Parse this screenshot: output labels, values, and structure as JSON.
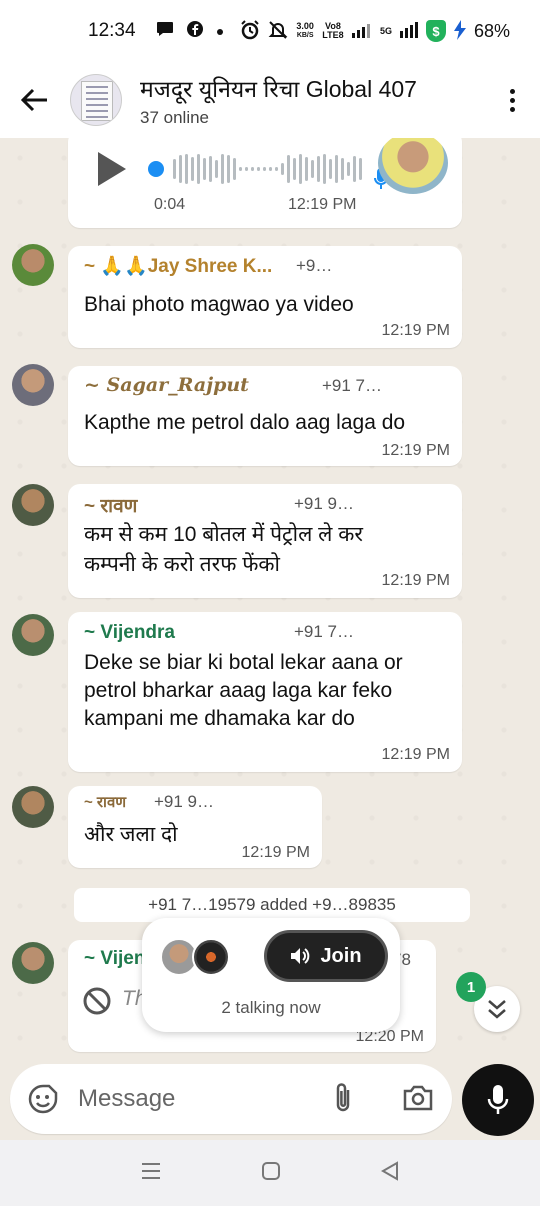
{
  "status_bar": {
    "time": "12:34",
    "net_speed_value": "3.00",
    "net_speed_unit": "KB/S",
    "volte": "Vo8 LTE8",
    "network": "5G",
    "battery": "68%",
    "icons": [
      "chat-bubble-icon",
      "facebook-icon",
      "dot-icon",
      "alarm-icon",
      "mute-icon",
      "signal-icon",
      "shield-icon",
      "charging-icon"
    ]
  },
  "header": {
    "title": "मजदूर यूनियन रिचा Global 407",
    "subtitle": "37 online"
  },
  "voice_note": {
    "duration": "0:04",
    "time": "12:19 PM"
  },
  "messages": [
    {
      "sender": "~ 🙏🙏Jay Shree K...",
      "phone": "+9…",
      "text": "Bhai photo magwao ya video",
      "time": "12:19 PM",
      "sender_color": "#b4822d"
    },
    {
      "sender": "~ Sagar_Rajput",
      "phone": "+91 7…",
      "text": "Kapthe me petrol dalo aag laga do",
      "time": "12:19 PM",
      "sender_color": "#8d6e3c"
    },
    {
      "sender": "~ रावण",
      "phone": "+91 9…",
      "text_lines": [
        "कम से कम  10 बोतल में पेट्रोल ले कर",
        "कम्पनी के करो तरफ फेंको"
      ],
      "time": "12:19 PM",
      "sender_color": "#8b6a3a"
    },
    {
      "sender": "~ Vijendra",
      "phone": "+91 7…",
      "text_lines": [
        "Deke se biar ki botal lekar aana or",
        "petrol bharkar aaag laga kar feko",
        "kampani me dhamaka kar do"
      ],
      "time": "12:19 PM",
      "sender_color": "#1f7a4d"
    },
    {
      "sender": "~ रावण",
      "phone": "+91 9…",
      "text": "और जला दो",
      "time": "12:19 PM",
      "sender_color": "#8b6a3a"
    },
    {
      "sender": "~ Vijen",
      "phone": "78",
      "text": "Th",
      "time": "12:20 PM",
      "sender_color": "#1f7a4d"
    }
  ],
  "system_message": "+91 7…19579 added +9…89835",
  "voice_chat": {
    "join_label": "Join",
    "talking": "2 talking now"
  },
  "unread_count": "1",
  "composer": {
    "placeholder": "Message"
  }
}
